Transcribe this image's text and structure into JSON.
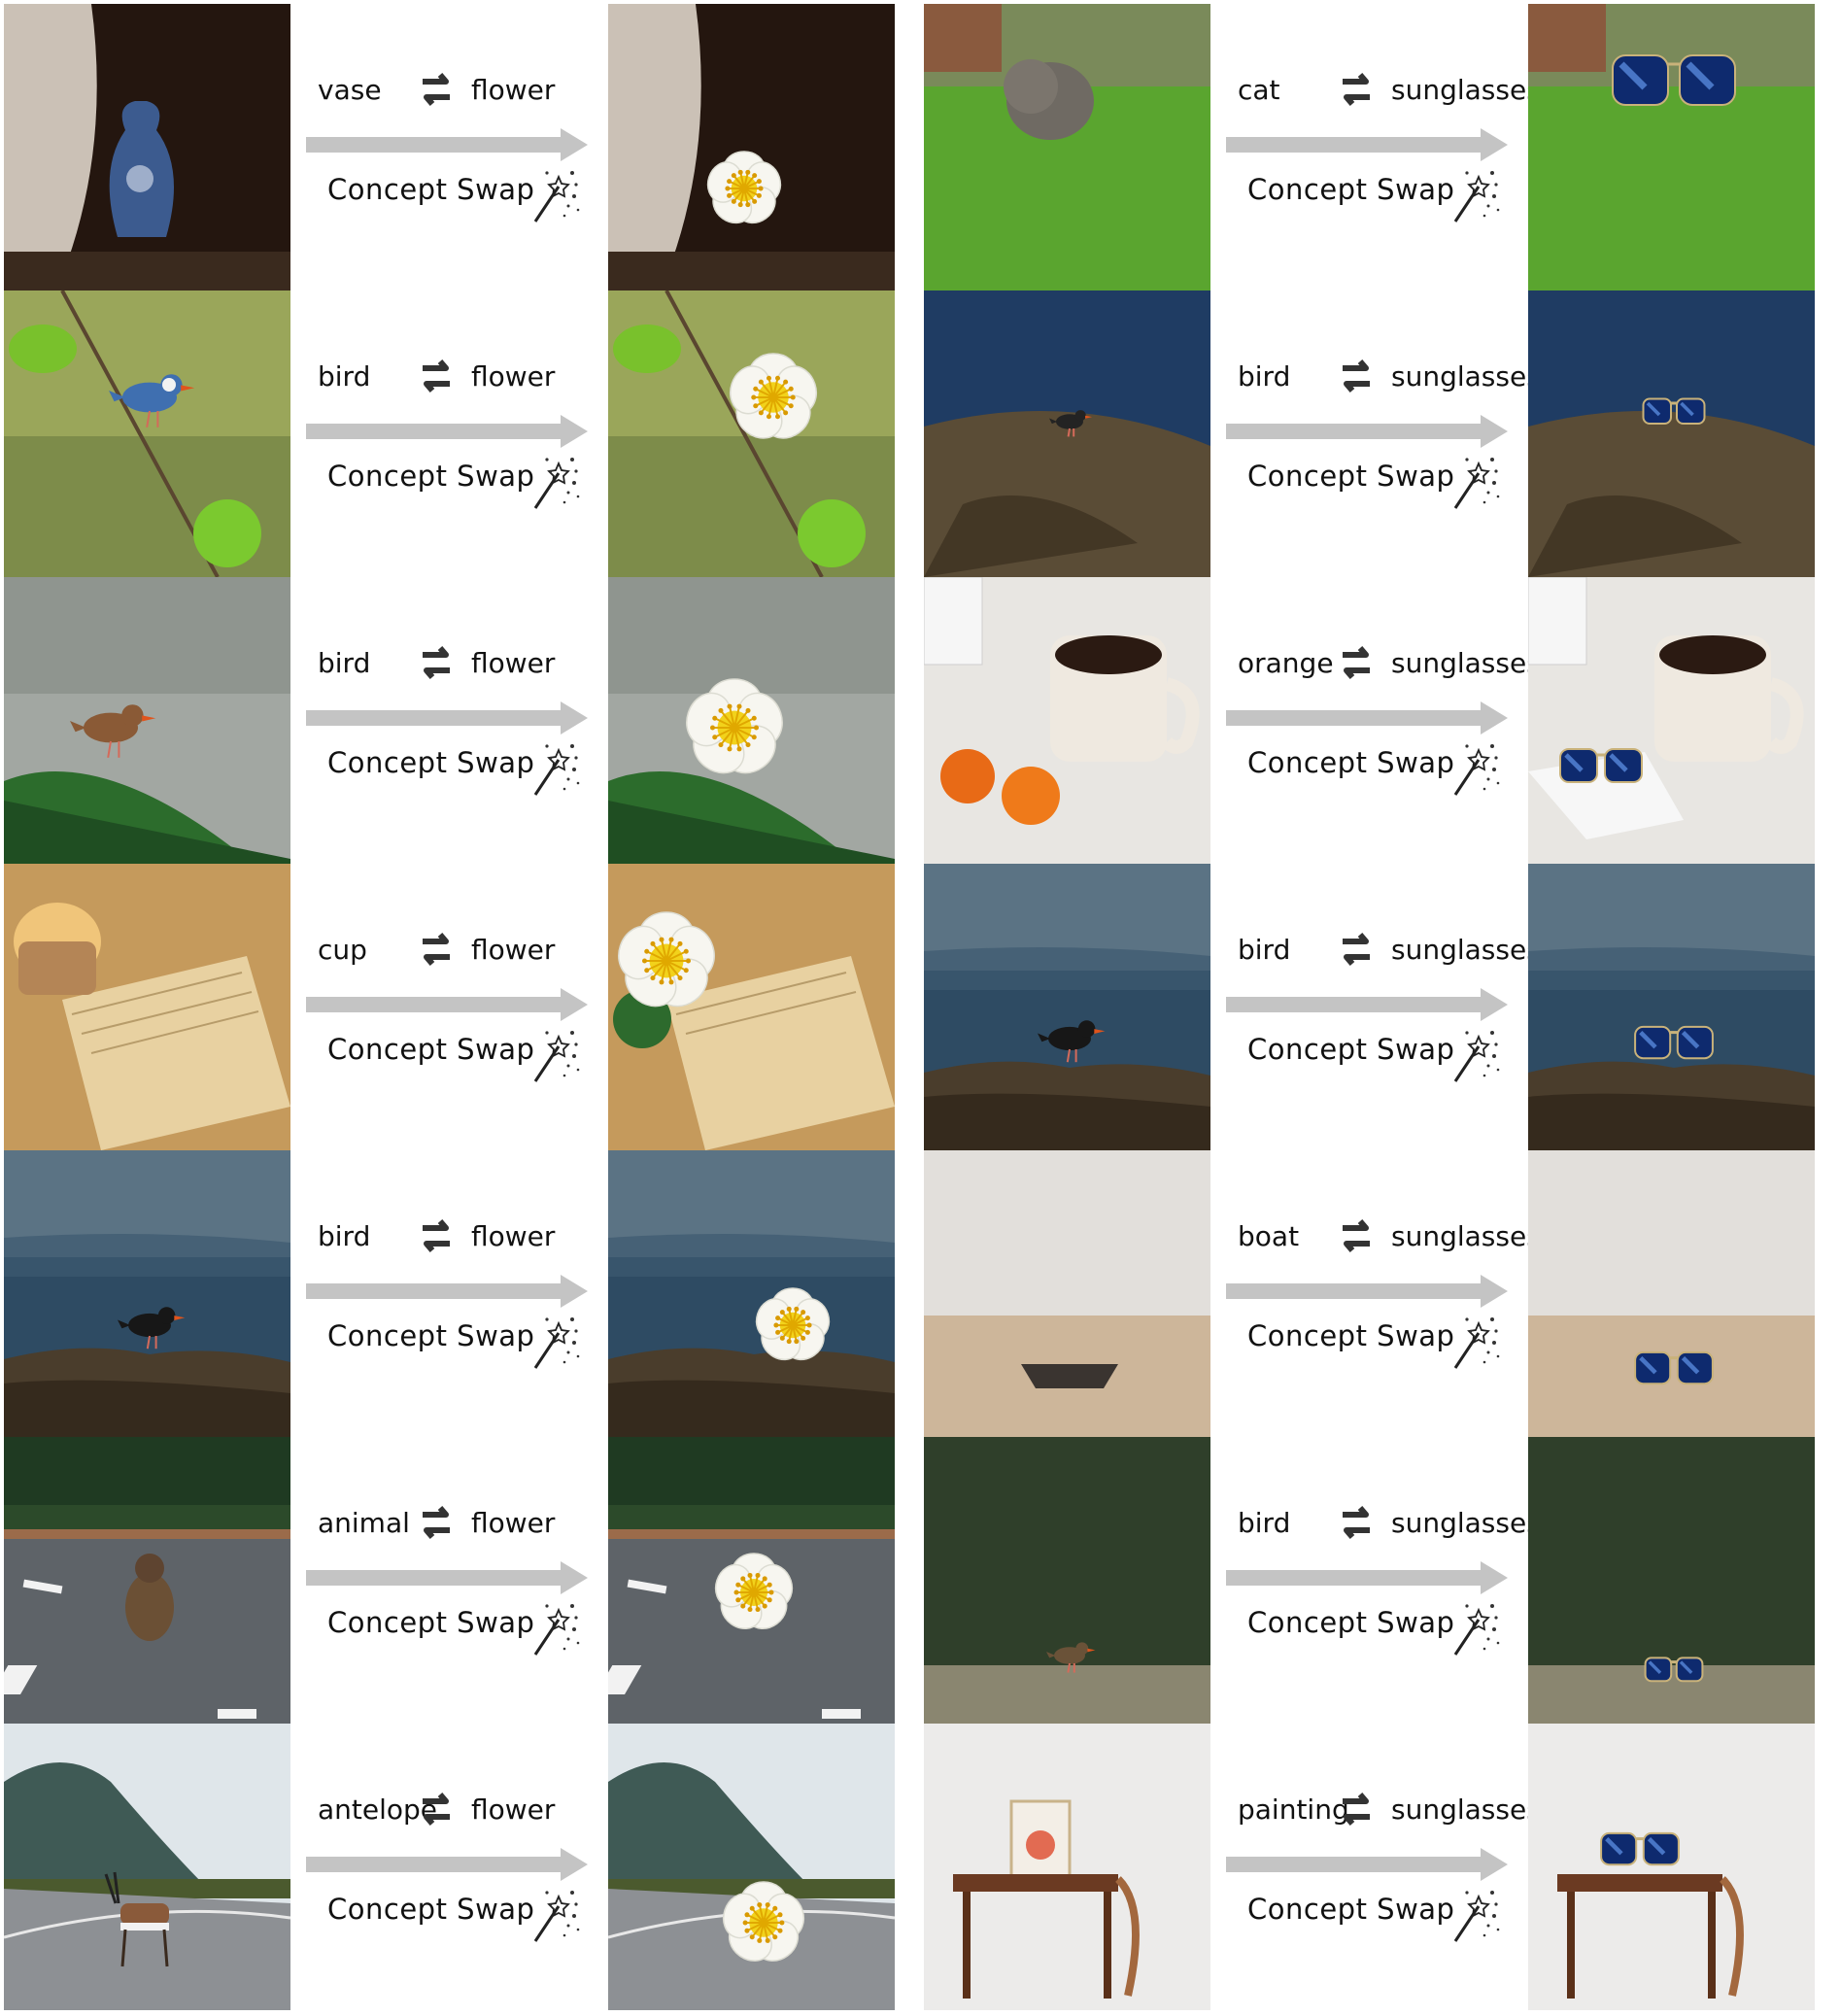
{
  "columns": [
    {
      "target": "flower",
      "rows": [
        {
          "source": "vase",
          "target": "flower",
          "caption": "Concept Swap",
          "src_scene": "vase-by-curtain",
          "dst_scene": "flower-by-curtain"
        },
        {
          "source": "bird",
          "target": "flower",
          "caption": "Concept Swap",
          "src_scene": "blue-tit-on-branch",
          "dst_scene": "flower-on-branch"
        },
        {
          "source": "bird",
          "target": "flower",
          "caption": "Concept Swap",
          "src_scene": "wren-on-pine",
          "dst_scene": "flower-on-pine"
        },
        {
          "source": "cup",
          "target": "flower",
          "caption": "Concept Swap",
          "src_scene": "cup-on-book",
          "dst_scene": "flower-on-book"
        },
        {
          "source": "bird",
          "target": "flower",
          "caption": "Concept Swap",
          "src_scene": "oystercatcher-on-rock",
          "dst_scene": "flower-on-rock"
        },
        {
          "source": "animal",
          "target": "flower",
          "caption": "Concept Swap",
          "src_scene": "monkey-on-road",
          "dst_scene": "flower-on-road"
        },
        {
          "source": "antelope",
          "target": "flower",
          "caption": "Concept Swap",
          "src_scene": "antelope-on-road",
          "dst_scene": "flower-on-coast-road"
        }
      ]
    },
    {
      "target": "sunglasses",
      "rows": [
        {
          "source": "cat",
          "target": "sunglasses",
          "caption": "Concept Swap",
          "src_scene": "kitten-on-grass",
          "dst_scene": "sunglasses-on-grass"
        },
        {
          "source": "bird",
          "target": "sunglasses",
          "caption": "Concept Swap",
          "src_scene": "bird-on-sea-rock",
          "dst_scene": "sunglasses-on-sea-rock"
        },
        {
          "source": "orange",
          "target": "sunglasses",
          "caption": "Concept Swap",
          "src_scene": "oranges-and-mug",
          "dst_scene": "sunglasses-and-mug"
        },
        {
          "source": "bird",
          "target": "sunglasses",
          "caption": "Concept Swap",
          "src_scene": "oystercatcher-on-rock",
          "dst_scene": "sunglasses-on-rock"
        },
        {
          "source": "boat",
          "target": "sunglasses",
          "caption": "Concept Swap",
          "src_scene": "boat-on-beach",
          "dst_scene": "sunglasses-on-beach"
        },
        {
          "source": "bird",
          "target": "sunglasses",
          "caption": "Concept Swap",
          "src_scene": "bird-by-forest",
          "dst_scene": "sunglasses-by-forest"
        },
        {
          "source": "painting",
          "target": "sunglasses",
          "caption": "Concept Swap",
          "src_scene": "painting-on-desk",
          "dst_scene": "sunglasses-on-desk"
        }
      ]
    }
  ],
  "icons": {
    "swap": "swap-arrows-icon",
    "wand": "magic-wand-icon",
    "arrow": "right-arrow"
  },
  "colors": {
    "arrow": "#c4c4c4",
    "text": "#111111",
    "background": "#ffffff"
  }
}
